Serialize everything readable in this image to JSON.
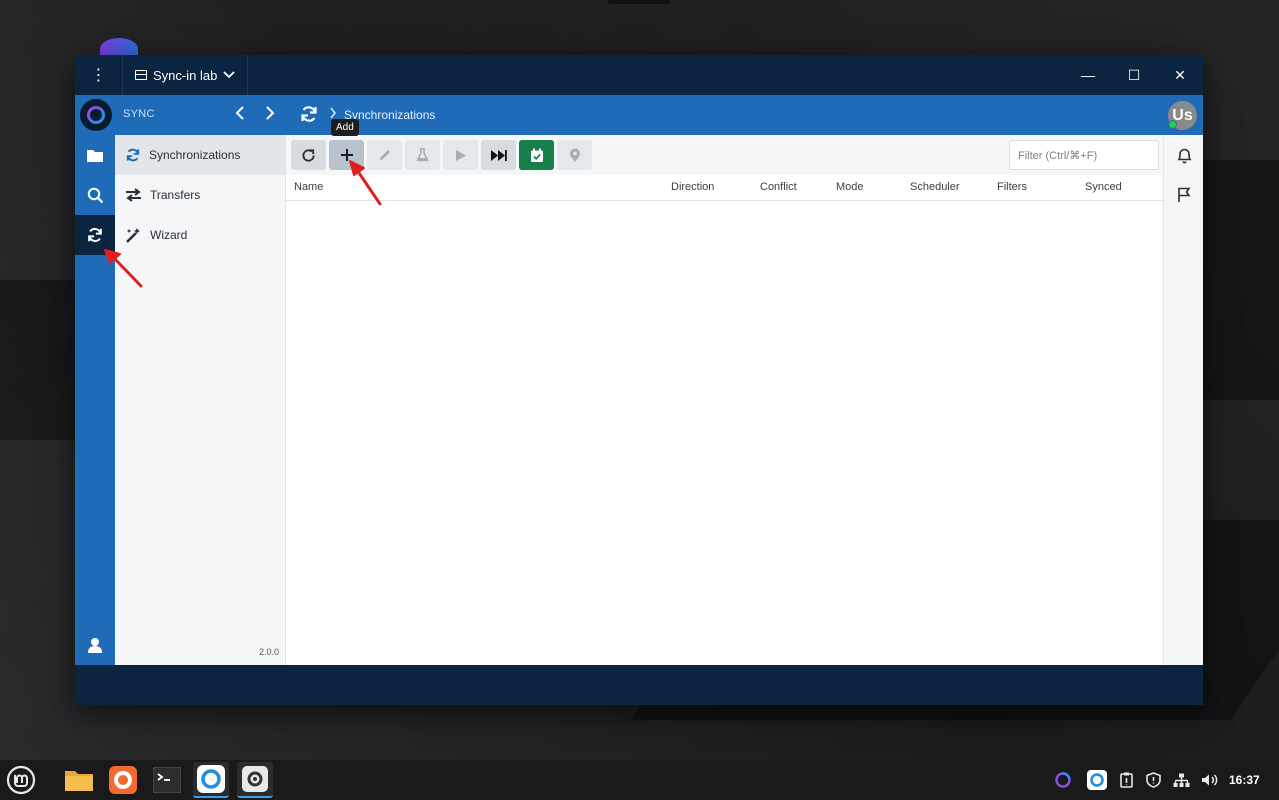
{
  "window": {
    "server_name": "Sync-in lab",
    "menu_glyph": "⋮",
    "minimize_glyph": "—",
    "maximize_glyph": "☐",
    "close_glyph": "✕"
  },
  "appbar": {
    "section_label": "SYNC",
    "breadcrumb_title": "Synchronizations",
    "avatar_initials": "Us"
  },
  "sidebar": {
    "items": [
      {
        "label": "Synchronizations",
        "icon": "sync-icon"
      },
      {
        "label": "Transfers",
        "icon": "transfer-icon"
      },
      {
        "label": "Wizard",
        "icon": "wand-icon"
      }
    ],
    "version": "2.0.0"
  },
  "toolbar": {
    "tooltip": "Add",
    "filter_placeholder": "Filter (Ctrl/⌘+F)"
  },
  "table": {
    "columns": [
      "Name",
      "Direction",
      "Conflict",
      "Mode",
      "Scheduler",
      "Filters",
      "Synced"
    ]
  },
  "taskbar": {
    "clock": "16:37"
  },
  "colors": {
    "accent": "#1f6bb8",
    "dark": "#0b2540",
    "green": "#17804a",
    "annotation": "#e02020"
  }
}
